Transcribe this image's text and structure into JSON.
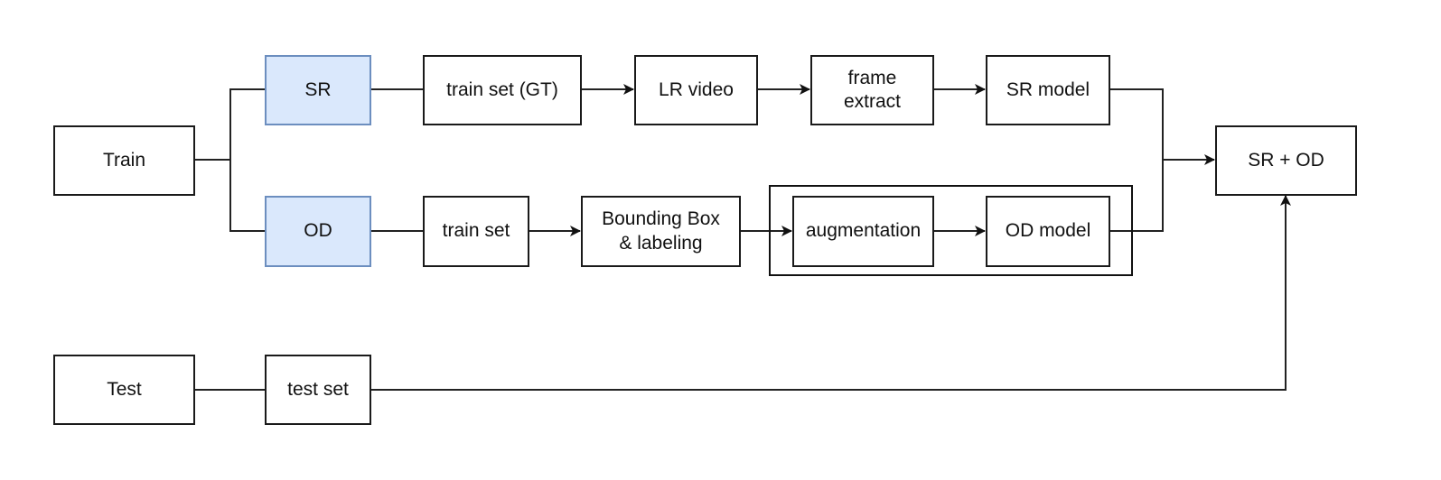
{
  "diagram": {
    "nodes": {
      "train": {
        "label": "Train"
      },
      "sr": {
        "label": "SR",
        "fill": "#dae8fc",
        "stroke": "#6c8ebf"
      },
      "od": {
        "label": "OD",
        "fill": "#dae8fc",
        "stroke": "#6c8ebf"
      },
      "train_set_gt": {
        "label": "train set (GT)"
      },
      "lr_video": {
        "label": "LR video"
      },
      "frame_extract": {
        "label": "frame\nextract"
      },
      "sr_model": {
        "label": "SR model"
      },
      "train_set": {
        "label": "train set"
      },
      "bbox_labeling": {
        "label": "Bounding Box\n& labeling"
      },
      "augmentation": {
        "label": "augmentation"
      },
      "od_model": {
        "label": "OD model"
      },
      "sr_od": {
        "label": "SR + OD"
      },
      "test": {
        "label": "Test"
      },
      "test_set": {
        "label": "test set"
      }
    },
    "edges": [
      {
        "from": "train",
        "to": "sr",
        "arrow": false
      },
      {
        "from": "train",
        "to": "od",
        "arrow": false
      },
      {
        "from": "sr",
        "to": "train_set_gt",
        "arrow": false
      },
      {
        "from": "train_set_gt",
        "to": "lr_video",
        "arrow": true
      },
      {
        "from": "lr_video",
        "to": "frame_extract",
        "arrow": true
      },
      {
        "from": "frame_extract",
        "to": "sr_model",
        "arrow": true
      },
      {
        "from": "sr_model",
        "to": "sr_od",
        "arrow": true
      },
      {
        "from": "od",
        "to": "train_set",
        "arrow": false
      },
      {
        "from": "train_set",
        "to": "bbox_labeling",
        "arrow": true
      },
      {
        "from": "bbox_labeling",
        "to": "augmentation",
        "arrow": true
      },
      {
        "from": "augmentation",
        "to": "od_model",
        "arrow": true
      },
      {
        "from": "od_model",
        "to": "sr_od",
        "arrow": true
      },
      {
        "from": "test",
        "to": "test_set",
        "arrow": false
      },
      {
        "from": "test_set",
        "to": "sr_od",
        "arrow": true
      }
    ],
    "groups": [
      {
        "members": [
          "augmentation",
          "od_model"
        ]
      }
    ]
  }
}
